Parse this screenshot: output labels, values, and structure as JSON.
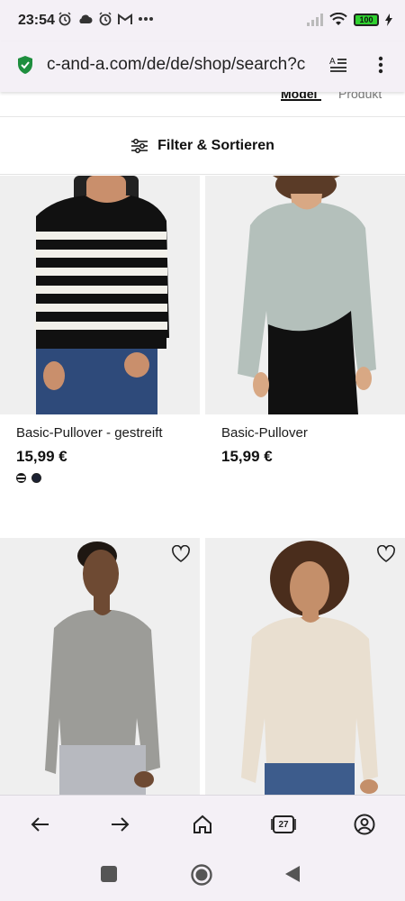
{
  "status_bar": {
    "time": "23:54",
    "left_icons": [
      "alarm-icon",
      "cloud-icon",
      "alarm-icon",
      "gmail-icon",
      "more-dots-icon"
    ],
    "battery": "100"
  },
  "browser": {
    "url": "c-and-a.com/de/de/shop/search?c",
    "tabs_count": "27"
  },
  "view_tabs": {
    "model": "Model",
    "product": "Produkt"
  },
  "filter": {
    "label": "Filter & Sortieren"
  },
  "products": [
    {
      "name": "Basic-Pullover - gestreift",
      "price": "15,99 €",
      "swatches": [
        "striped",
        "dark-navy"
      ],
      "favorite_visible": false
    },
    {
      "name": "Basic-Pullover",
      "price": "15,99 €",
      "swatches": [],
      "favorite_visible": false
    },
    {
      "name": "",
      "price": "",
      "swatches": [],
      "favorite_visible": true
    },
    {
      "name": "",
      "price": "",
      "swatches": [],
      "favorite_visible": true
    }
  ],
  "colors": {
    "chrome_bg": "#f4f0f6",
    "lock_green": "#1e8e3e",
    "battery_green": "#2fd12f"
  }
}
